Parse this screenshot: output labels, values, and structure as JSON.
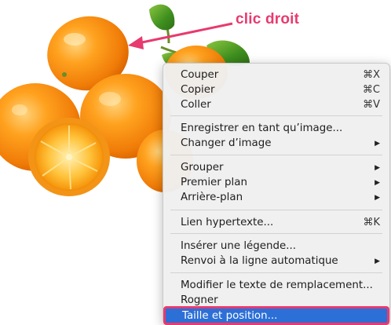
{
  "annotation": {
    "label": "clic droit",
    "color": "#e83a6f"
  },
  "menu": {
    "highlight_color": "#2c6fd6",
    "items": [
      {
        "label": "Couper",
        "shortcut": "⌘X"
      },
      {
        "label": "Copier",
        "shortcut": "⌘C"
      },
      {
        "label": "Coller",
        "shortcut": "⌘V"
      },
      {
        "label": "Enregistrer en tant qu’image..."
      },
      {
        "label": "Changer d’image",
        "submenu": "▶"
      },
      {
        "label": "Grouper",
        "submenu": "▶"
      },
      {
        "label": "Premier plan",
        "submenu": "▶"
      },
      {
        "label": "Arrière-plan",
        "submenu": "▶"
      },
      {
        "label": "Lien hypertexte...",
        "shortcut": "⌘K"
      },
      {
        "label": "Insérer une légende..."
      },
      {
        "label": "Renvoi à la ligne automatique",
        "submenu": "▶"
      },
      {
        "label": "Modifier le texte de remplacement..."
      },
      {
        "label": "Rogner"
      },
      {
        "label": "Taille et position..."
      }
    ]
  }
}
